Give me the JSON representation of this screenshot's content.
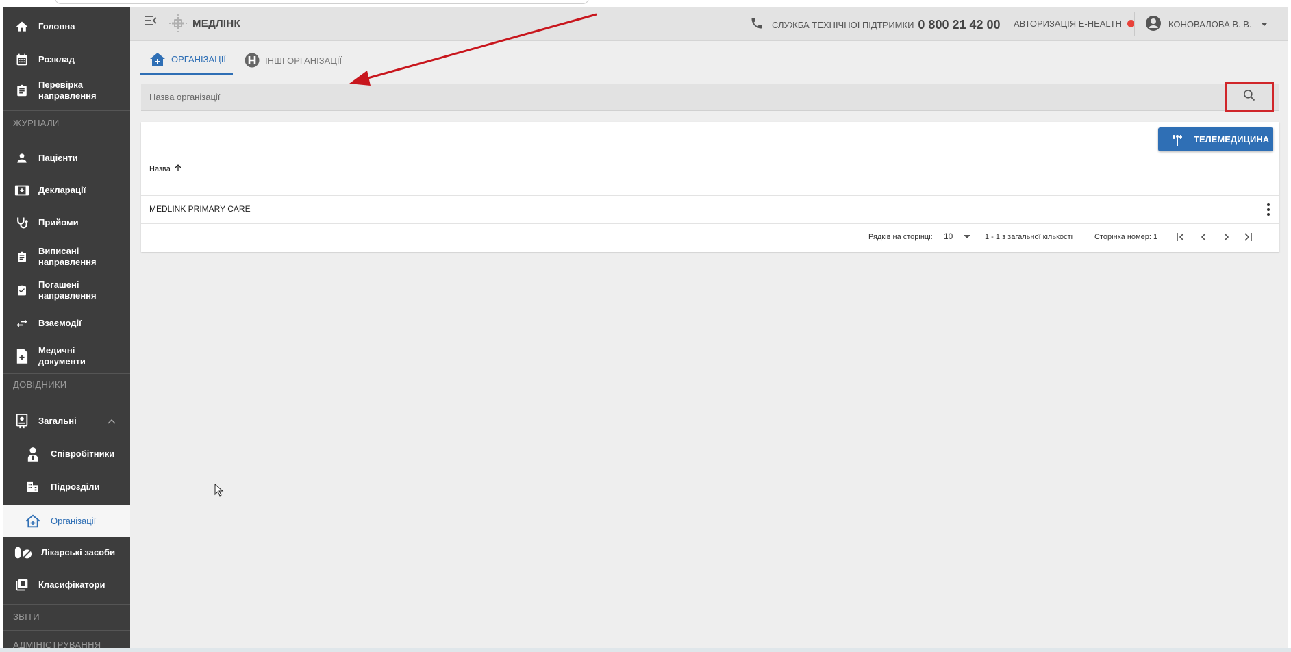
{
  "sidebar": {
    "items": [
      {
        "label": "Головна",
        "icon": "home-icon"
      },
      {
        "label": "Розклад",
        "icon": "calendar-icon"
      },
      {
        "label": "Перевірка направлення",
        "icon": "clipboard-icon"
      },
      {
        "label": "Пацієнти",
        "icon": "person-icon"
      },
      {
        "label": "Декларації",
        "icon": "declaration-icon"
      },
      {
        "label": "Прийоми",
        "icon": "stethoscope-icon"
      },
      {
        "label": "Виписані направлення",
        "icon": "clipboard-icon"
      },
      {
        "label": "Погашені направлення",
        "icon": "clipboard-check-icon"
      },
      {
        "label": "Взаємодії",
        "icon": "swap-icon"
      },
      {
        "label": "Медичні документи",
        "icon": "medical-document-icon"
      },
      {
        "label": "Загальні",
        "icon": "badge-icon"
      },
      {
        "label": "Співробітники",
        "icon": "doctor-icon"
      },
      {
        "label": "Підрозділи",
        "icon": "building-icon"
      },
      {
        "label": "Організації",
        "icon": "hospital-icon"
      },
      {
        "label": "Лікарські засоби",
        "icon": "pills-icon"
      },
      {
        "label": "Класифікатори",
        "icon": "library-icon"
      }
    ],
    "sections": {
      "journals": "ЖУРНАЛИ",
      "references": "ДОВІДНИКИ",
      "reports": "ЗВІТИ",
      "admin": "АДМІНІСТРУВАННЯ"
    },
    "active": "Організації"
  },
  "header": {
    "brand": "МЕДЛІНК",
    "support_label": "СЛУЖБА ТЕХНІЧНОЇ ПІДТРИМКИ",
    "support_phone": "0 800 21 42 00",
    "ehealth_label": "АВТОРИЗАЦІЯ E-HEALTH",
    "ehealth_status_color": "#e8423a",
    "user_name": "КОНОВАЛОВА В. В."
  },
  "tabs": [
    {
      "label": "ОРГАНІЗАЦІЇ",
      "active": true
    },
    {
      "label": "ІНШІ ОРГАНІЗАЦІЇ",
      "active": false
    }
  ],
  "search": {
    "placeholder": "Назва організації",
    "value": ""
  },
  "table": {
    "action_button": "ТЕЛЕМЕДИЦИНА",
    "column_header": "Назва",
    "sort": "ascending",
    "rows": [
      {
        "name": "MEDLINK PRIMARY CARE"
      }
    ],
    "pager": {
      "rows_per_page_label": "Рядків на сторінці:",
      "rows_per_page_value": "10",
      "range_text": "1 - 1 з загальної кількості",
      "page_text": "Сторінка номер: 1"
    }
  },
  "colors": {
    "accent": "#2f6fb5",
    "sidebar_bg": "#3d3d3d",
    "annotation_red": "#d0262a"
  }
}
